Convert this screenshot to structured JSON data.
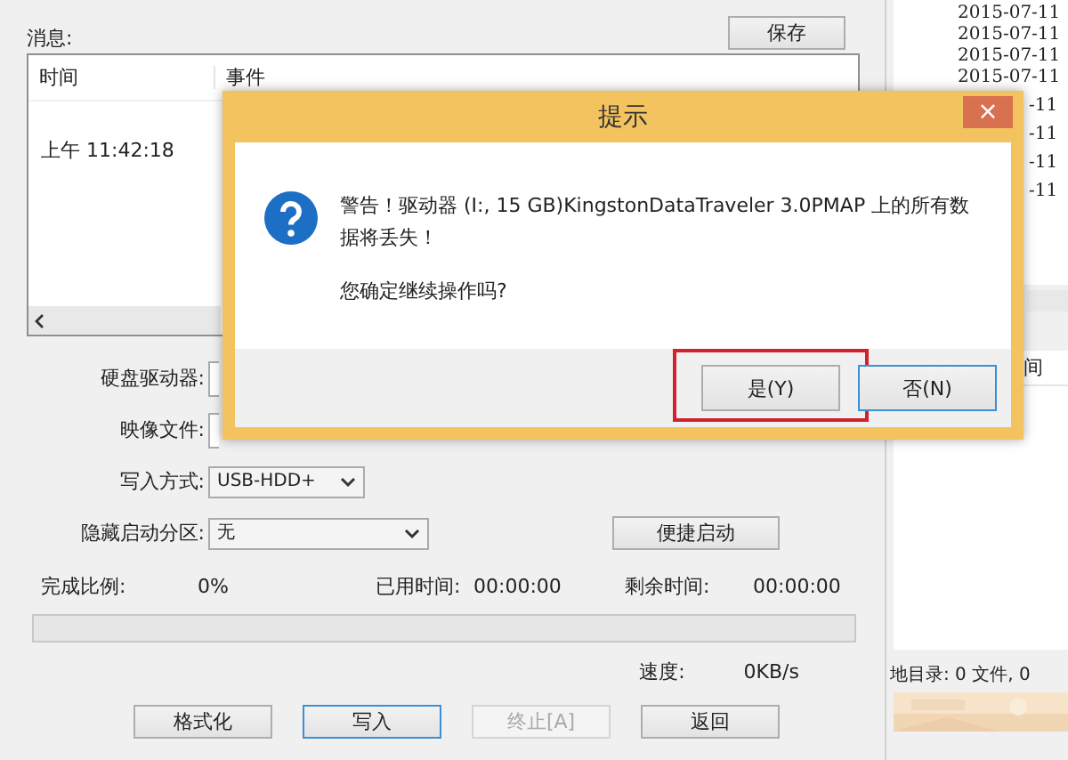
{
  "messages": {
    "label": "消息:",
    "save_button": "保存",
    "columns": [
      "时间",
      "事件"
    ],
    "rows": [
      {
        "time": "上午 11:42:18"
      }
    ]
  },
  "form": {
    "fields": [
      {
        "kind": "field",
        "label": "硬盘驱动器:"
      },
      {
        "kind": "field",
        "label": "映像文件:"
      },
      {
        "kind": "select",
        "label": "写入方式:",
        "value": "USB-HDD+"
      },
      {
        "kind": "select",
        "label": "隐藏启动分区:",
        "value": "无",
        "button": "便捷启动"
      }
    ]
  },
  "progress": {
    "stats": [
      {
        "label": "完成比例:",
        "value": "0%"
      },
      {
        "label": "已用时间:",
        "value": "00:00:00"
      },
      {
        "label": "剩余时间:",
        "value": "00:00:00"
      }
    ],
    "level": 0,
    "speed_label": "速度:",
    "speed_value": "0KB/s"
  },
  "buttons": [
    {
      "label": "格式化",
      "focused": false,
      "disabled": false
    },
    {
      "label": "写入",
      "focused": true,
      "disabled": false
    },
    {
      "label": "终止[A]",
      "focused": false,
      "disabled": true
    },
    {
      "label": "返回",
      "focused": false,
      "disabled": false
    }
  ],
  "log": {
    "rows": [
      {
        "kind": "full",
        "text": "2015-07-11"
      },
      {
        "kind": "full",
        "text": "2015-07-11"
      },
      {
        "kind": "full",
        "text": "2015-07-11"
      },
      {
        "kind": "full",
        "text": "2015-07-11"
      },
      {
        "kind": "partial",
        "text": "-11"
      },
      {
        "kind": "partial",
        "text": "-11"
      },
      {
        "kind": "partial",
        "text": "-11"
      },
      {
        "kind": "partial",
        "text": "-11"
      }
    ],
    "column_header": "间",
    "status": "地目录: 0 文件, 0"
  },
  "dialog": {
    "title": "提示",
    "close": "×",
    "message": "警告！驱动器 (I:, 15 GB)KingstonDataTraveler 3.0PMAP 上的所有数据将丢失！",
    "question": "您确定继续操作吗?",
    "buttons": [
      {
        "label": "是(Y)",
        "default": false,
        "highlighted": true
      },
      {
        "label": "否(N)",
        "default": true,
        "highlighted": false
      }
    ]
  }
}
